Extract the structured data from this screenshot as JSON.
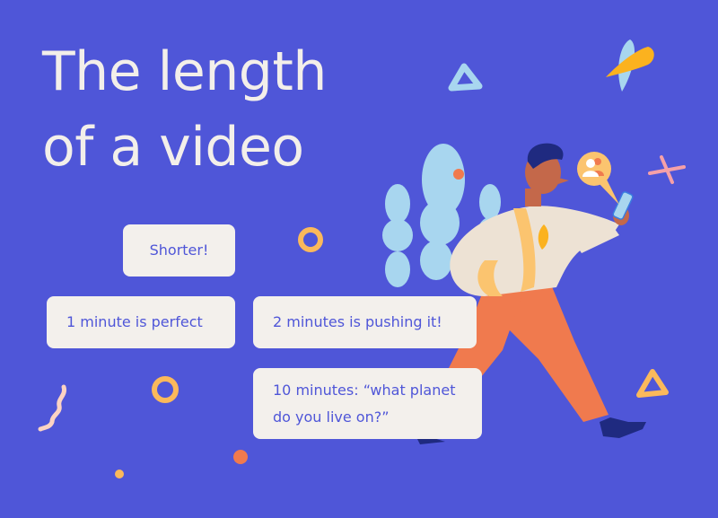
{
  "title": {
    "line1": "The length",
    "line2": "of a video"
  },
  "bubbles": [
    {
      "text": "Shorter!"
    },
    {
      "text": "1 minute is perfect"
    },
    {
      "text": "2 minutes is pushing it!"
    },
    {
      "text_line1": "10 minutes: “what planet",
      "text_line2": "do you live on?”"
    }
  ],
  "illustration": {
    "subject": "man walking while looking at phone",
    "notification_icon": "users-icon"
  },
  "colors": {
    "background": "#4f56d8",
    "bubble": "#f3f0ec",
    "bubble_text": "#4f56d8",
    "title_text": "#f3efea",
    "accent_orange": "#f07a4e",
    "accent_yellow": "#fbb95b",
    "accent_lightblue": "#a8d6ef",
    "accent_pink": "#f5a0a8"
  }
}
